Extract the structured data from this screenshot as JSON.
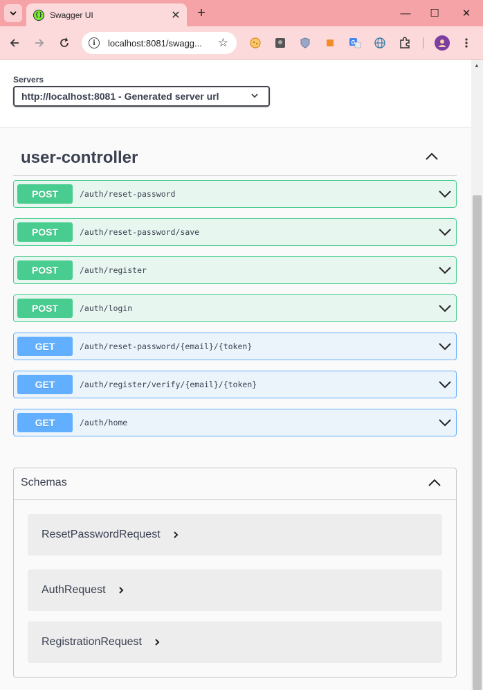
{
  "browser": {
    "tab_title": "Swagger UI",
    "favicon_glyph": "{}",
    "url": "localhost:8081/swagg...",
    "window_controls": {
      "minimize": "—",
      "maximize": "☐",
      "close": "✕"
    },
    "extensions": [
      "cookie-icon",
      "terminal-icon",
      "shield-icon",
      "puzzle-orange-icon",
      "translate-icon",
      "globe-icon",
      "extensions-icon",
      "profile-avatar"
    ]
  },
  "servers": {
    "label": "Servers",
    "selected": "http://localhost:8081 - Generated server url"
  },
  "tag": {
    "name": "user-controller"
  },
  "operations": [
    {
      "method": "POST",
      "path": "/auth/reset-password"
    },
    {
      "method": "POST",
      "path": "/auth/reset-password/save"
    },
    {
      "method": "POST",
      "path": "/auth/register"
    },
    {
      "method": "POST",
      "path": "/auth/login"
    },
    {
      "method": "GET",
      "path": "/auth/reset-password/{email}/{token}"
    },
    {
      "method": "GET",
      "path": "/auth/register/verify/{email}/{token}"
    },
    {
      "method": "GET",
      "path": "/auth/home"
    }
  ],
  "schemas": {
    "title": "Schemas",
    "models": [
      {
        "name": "ResetPasswordRequest"
      },
      {
        "name": "AuthRequest"
      },
      {
        "name": "RegistrationRequest"
      }
    ]
  },
  "colors": {
    "post": "#49cc90",
    "get": "#61affe",
    "browser_frame": "#f5a3a6",
    "text": "#3b4151"
  }
}
